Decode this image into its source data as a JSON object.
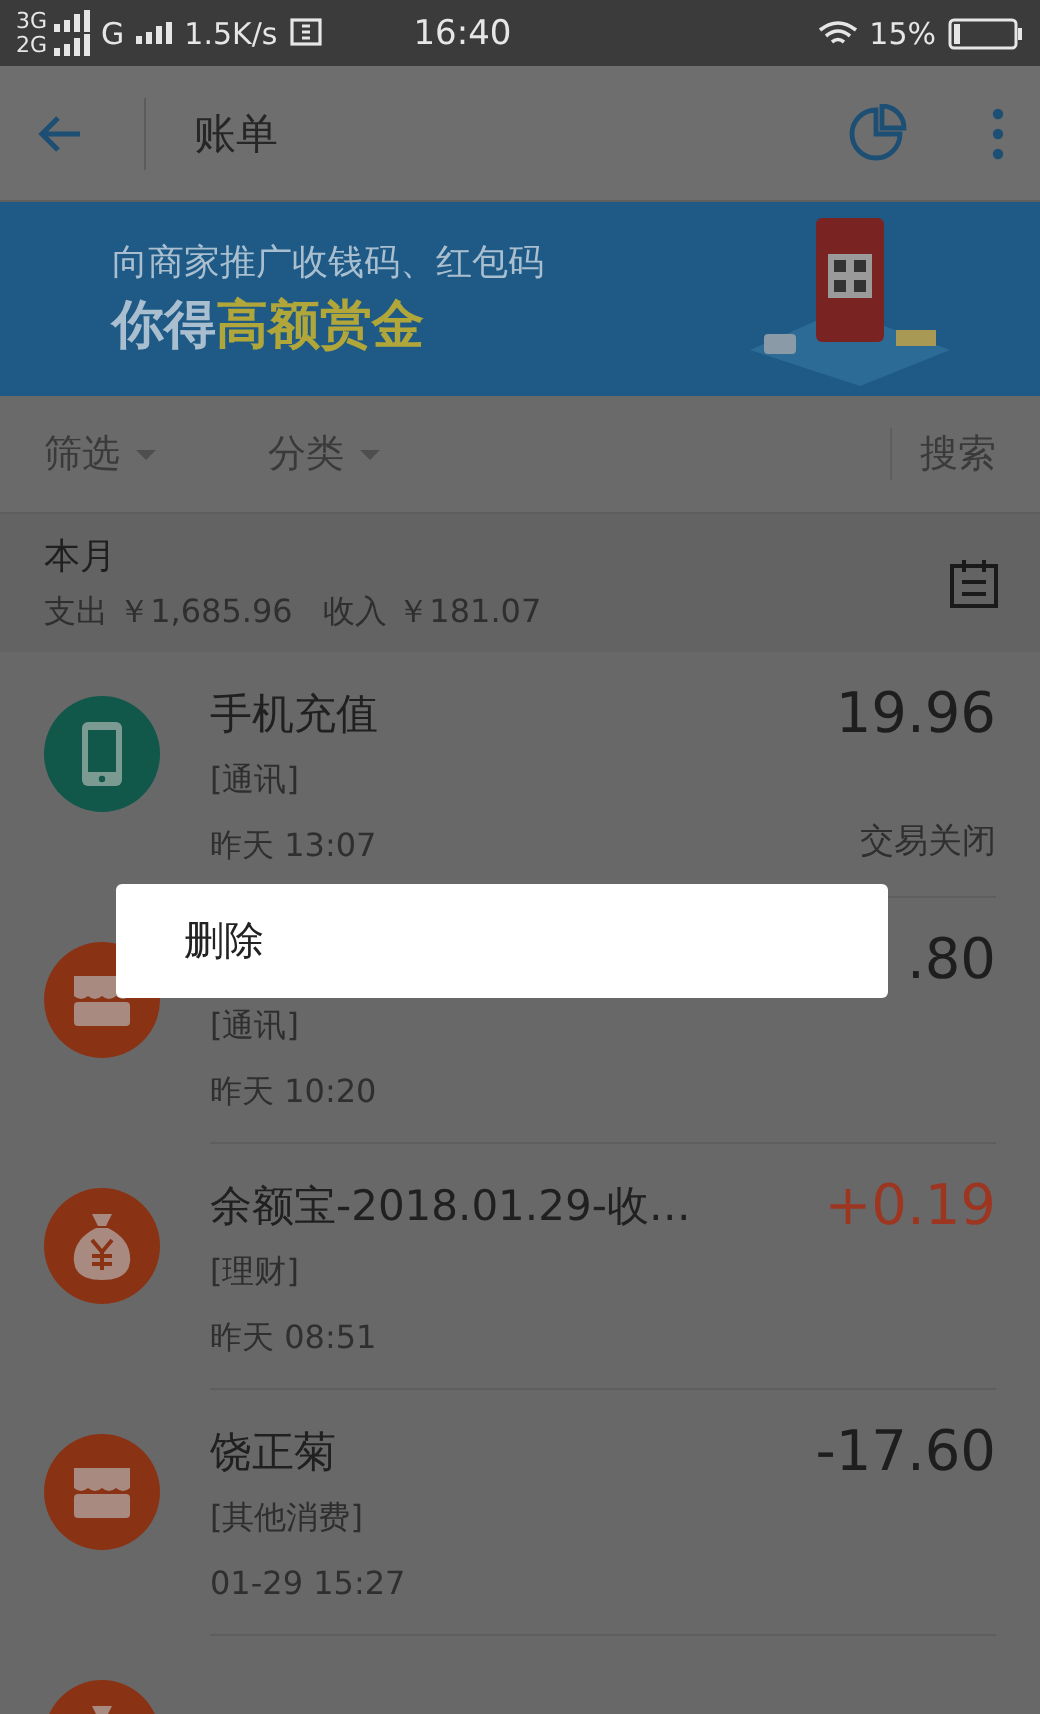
{
  "status_bar": {
    "net_top": "3G",
    "net_bottom": "2G",
    "net_second": "G",
    "speed": "1.5K/s",
    "time": "16:40",
    "battery": "15%"
  },
  "header": {
    "title": "账单"
  },
  "banner": {
    "line1": "向商家推广收钱码、红包码",
    "headline_prefix": "你得",
    "headline_highlight": "高额赏金"
  },
  "filters": [
    {
      "label": "筛选"
    },
    {
      "label": "分类"
    }
  ],
  "search": {
    "label": "搜索"
  },
  "month": {
    "title": "本月",
    "summary": "支出 ￥1,685.96   收入 ￥181.07"
  },
  "rows": [
    {
      "kind": "phone",
      "title": "手机充值",
      "category": "[通讯]",
      "time": "昨天  13:07",
      "amount": "19.96",
      "income": false,
      "status": "交易关闭"
    },
    {
      "kind": "shop",
      "category": "[通讯]",
      "time": "昨天  10:20",
      "amount": ".80",
      "income": false
    },
    {
      "kind": "moneybag",
      "title": "余额宝-2018.01.29-收…",
      "category": "[理财]",
      "time": "昨天  08:51",
      "amount": "+0.19",
      "income": true
    },
    {
      "kind": "shop",
      "title": "饶正菊",
      "category": "[其他消费]",
      "time": "01-29  15:27",
      "amount": "-17.60",
      "income": false
    },
    {
      "kind": "moneybag"
    }
  ],
  "popup_menu": {
    "items": [
      "删除"
    ]
  }
}
